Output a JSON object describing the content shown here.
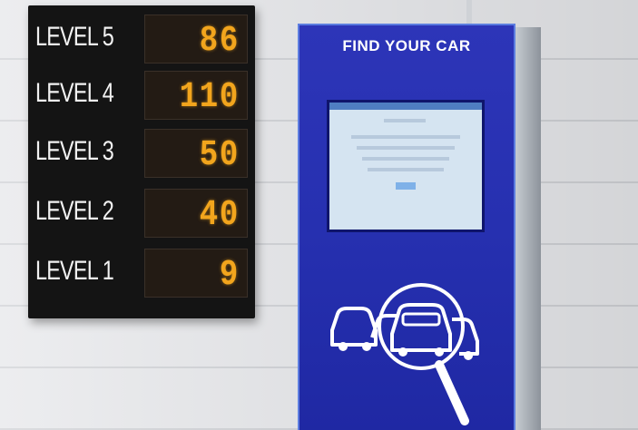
{
  "board": {
    "rows": [
      {
        "level": "LEVEL 5",
        "count": "86"
      },
      {
        "level": "LEVEL 4",
        "count": "110"
      },
      {
        "level": "LEVEL 3",
        "count": "50"
      },
      {
        "level": "LEVEL 2",
        "count": "40"
      },
      {
        "level": "LEVEL 1",
        "count": "9"
      }
    ],
    "led_color": "#f2a51d"
  },
  "kiosk": {
    "title": "FIND YOUR CAR",
    "color": "#2630b0",
    "icon": "car-search-icon"
  }
}
